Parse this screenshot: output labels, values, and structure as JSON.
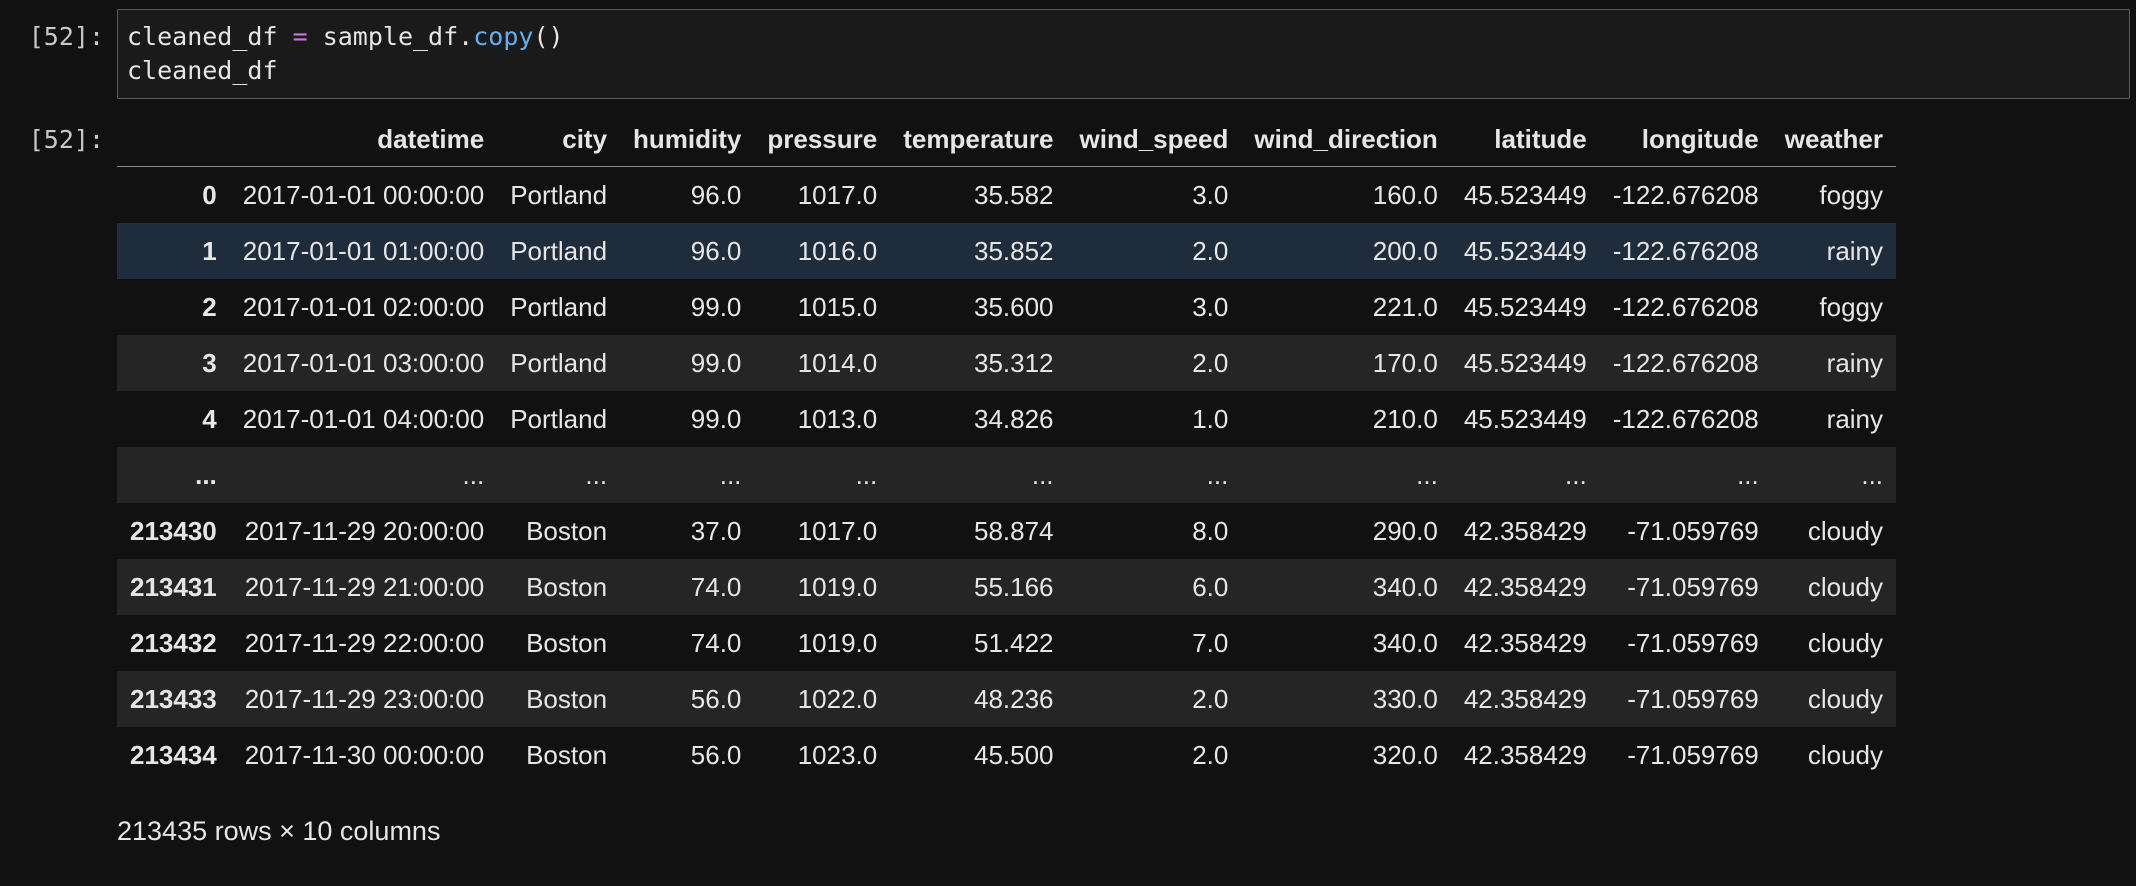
{
  "cell": {
    "input_prompt": "[52]:",
    "output_prompt": "[52]:",
    "code": {
      "line1_var": "cleaned_df",
      "line1_op": "=",
      "line1_obj": "sample_df.",
      "line1_fn": "copy",
      "line1_parens": "()",
      "line2": "cleaned_df"
    },
    "colors": {
      "operator": "#c678dd",
      "function": "#61afef",
      "selected_row": "#1f2c3c"
    }
  },
  "dataframe": {
    "columns": [
      "datetime",
      "city",
      "humidity",
      "pressure",
      "temperature",
      "wind_speed",
      "wind_direction",
      "latitude",
      "longitude",
      "weather"
    ],
    "rows": [
      {
        "index": "0",
        "values": [
          "2017-01-01 00:00:00",
          "Portland",
          "96.0",
          "1017.0",
          "35.582",
          "3.0",
          "160.0",
          "45.523449",
          "-122.676208",
          "foggy"
        ]
      },
      {
        "index": "1",
        "values": [
          "2017-01-01 01:00:00",
          "Portland",
          "96.0",
          "1016.0",
          "35.852",
          "2.0",
          "200.0",
          "45.523449",
          "-122.676208",
          "rainy"
        ],
        "selected": true
      },
      {
        "index": "2",
        "values": [
          "2017-01-01 02:00:00",
          "Portland",
          "99.0",
          "1015.0",
          "35.600",
          "3.0",
          "221.0",
          "45.523449",
          "-122.676208",
          "foggy"
        ]
      },
      {
        "index": "3",
        "values": [
          "2017-01-01 03:00:00",
          "Portland",
          "99.0",
          "1014.0",
          "35.312",
          "2.0",
          "170.0",
          "45.523449",
          "-122.676208",
          "rainy"
        ]
      },
      {
        "index": "4",
        "values": [
          "2017-01-01 04:00:00",
          "Portland",
          "99.0",
          "1013.0",
          "34.826",
          "1.0",
          "210.0",
          "45.523449",
          "-122.676208",
          "rainy"
        ]
      },
      {
        "index": "...",
        "values": [
          "...",
          "...",
          "...",
          "...",
          "...",
          "...",
          "...",
          "...",
          "...",
          "..."
        ]
      },
      {
        "index": "213430",
        "values": [
          "2017-11-29 20:00:00",
          "Boston",
          "37.0",
          "1017.0",
          "58.874",
          "8.0",
          "290.0",
          "42.358429",
          "-71.059769",
          "cloudy"
        ]
      },
      {
        "index": "213431",
        "values": [
          "2017-11-29 21:00:00",
          "Boston",
          "74.0",
          "1019.0",
          "55.166",
          "6.0",
          "340.0",
          "42.358429",
          "-71.059769",
          "cloudy"
        ]
      },
      {
        "index": "213432",
        "values": [
          "2017-11-29 22:00:00",
          "Boston",
          "74.0",
          "1019.0",
          "51.422",
          "7.0",
          "340.0",
          "42.358429",
          "-71.059769",
          "cloudy"
        ]
      },
      {
        "index": "213433",
        "values": [
          "2017-11-29 23:00:00",
          "Boston",
          "56.0",
          "1022.0",
          "48.236",
          "2.0",
          "330.0",
          "42.358429",
          "-71.059769",
          "cloudy"
        ]
      },
      {
        "index": "213434",
        "values": [
          "2017-11-30 00:00:00",
          "Boston",
          "56.0",
          "1023.0",
          "45.500",
          "2.0",
          "320.0",
          "42.358429",
          "-71.059769",
          "cloudy"
        ]
      }
    ],
    "shape_text": "213435 rows × 10 columns"
  }
}
